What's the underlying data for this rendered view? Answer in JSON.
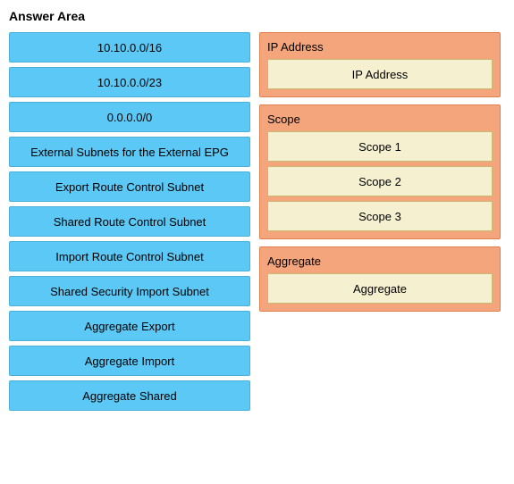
{
  "title": "Answer Area",
  "left_items": [
    {
      "id": "item-1",
      "label": "10.10.0.0/16"
    },
    {
      "id": "item-2",
      "label": "10.10.0.0/23"
    },
    {
      "id": "item-3",
      "label": "0.0.0.0/0"
    },
    {
      "id": "item-4",
      "label": "External Subnets for the External EPG"
    },
    {
      "id": "item-5",
      "label": "Export Route Control Subnet"
    },
    {
      "id": "item-6",
      "label": "Shared Route Control Subnet"
    },
    {
      "id": "item-7",
      "label": "Import Route Control Subnet"
    },
    {
      "id": "item-8",
      "label": "Shared Security Import Subnet"
    },
    {
      "id": "item-9",
      "label": "Aggregate Export"
    },
    {
      "id": "item-10",
      "label": "Aggregate Import"
    },
    {
      "id": "item-11",
      "label": "Aggregate Shared"
    }
  ],
  "right_groups": [
    {
      "id": "group-ip",
      "title": "IP Address",
      "slots": [
        {
          "id": "slot-ip-1",
          "label": "IP Address"
        }
      ]
    },
    {
      "id": "group-scope",
      "title": "Scope",
      "slots": [
        {
          "id": "slot-scope-1",
          "label": "Scope 1"
        },
        {
          "id": "slot-scope-2",
          "label": "Scope 2"
        },
        {
          "id": "slot-scope-3",
          "label": "Scope 3"
        }
      ]
    },
    {
      "id": "group-aggregate",
      "title": "Aggregate",
      "slots": [
        {
          "id": "slot-agg-1",
          "label": "Aggregate"
        }
      ]
    }
  ]
}
